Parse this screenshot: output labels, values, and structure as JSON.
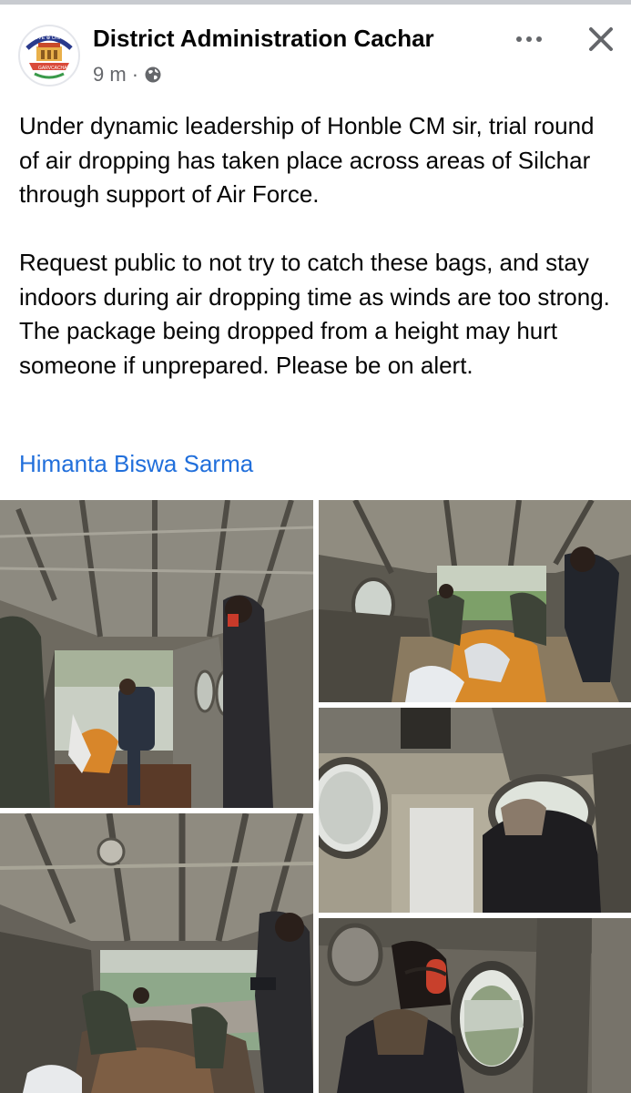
{
  "post": {
    "page_name": "District Administration Cachar",
    "timestamp": "9 m",
    "separator": "·",
    "privacy_icon": "globe-icon",
    "more_icon": "more-dots-icon",
    "close_icon": "close-icon",
    "avatar_text": {
      "top": "LOVE ⊕ UNITY",
      "bottom_left": "GARV",
      "bottom_right": "CACHAR"
    },
    "paragraphs": [
      "Under dynamic leadership of Honble CM sir,  trial round of air dropping has taken place across areas of Silchar through support of Air Force.",
      "Request public to not try to catch these bags,  and stay indoors during air dropping time as winds are too strong.  The package being dropped from a height may hurt someone if unprepared.  Please be on alert."
    ],
    "mention": "Himanta Biswa Sarma"
  },
  "photos": [
    {
      "name": "photo-helicopter-cabin-rear-door"
    },
    {
      "name": "photo-crew-pushing-relief-bags"
    },
    {
      "name": "photo-person-at-porthole-window"
    },
    {
      "name": "photo-relief-bags-at-open-ramp"
    },
    {
      "name": "photo-woman-with-ear-protection-at-window"
    }
  ],
  "colors": {
    "link": "#216fdb",
    "text": "#050505",
    "secondary": "#65676b"
  }
}
